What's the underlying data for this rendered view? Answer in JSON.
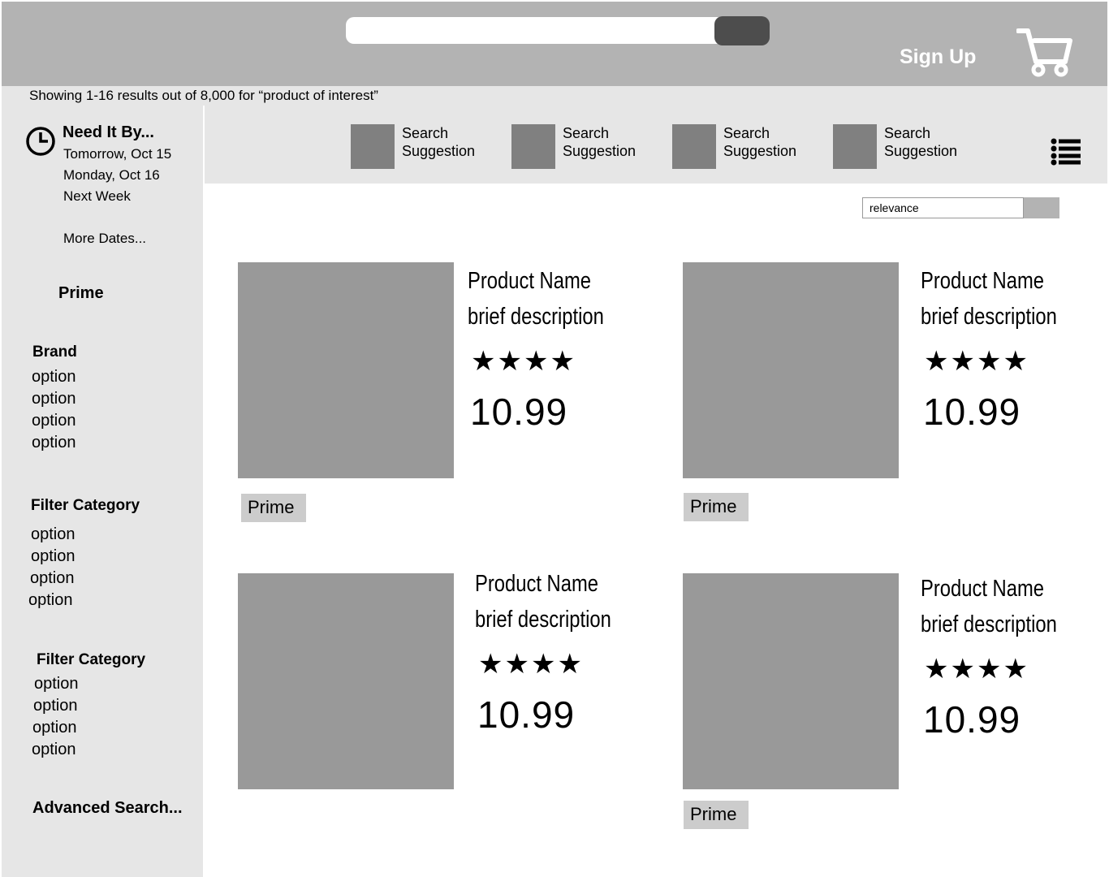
{
  "header": {
    "search_placeholder": "",
    "signup_label": "Sign Up",
    "cart_icon": "cart-icon"
  },
  "results_text": "Showing 1-16 results out of 8,000 for “product of interest”",
  "sidebar": {
    "need_it": {
      "title": "Need It By...",
      "dates": [
        "Tomorrow, Oct 15",
        "Monday, Oct 16",
        "Next Week"
      ],
      "more": "More Dates..."
    },
    "prime_label": "Prime",
    "brand": {
      "title": "Brand",
      "options": [
        "option",
        "option",
        "option",
        "option"
      ]
    },
    "filter1": {
      "title": "Filter Category",
      "options": [
        "option",
        "option",
        "option",
        "option"
      ]
    },
    "filter2": {
      "title": "Filter Category",
      "options": [
        "option",
        "option",
        "option",
        "option"
      ]
    },
    "advanced": "Advanced Search..."
  },
  "suggestions": [
    {
      "line1": "Search",
      "line2": "Suggestion"
    },
    {
      "line1": "Search",
      "line2": "Suggestion"
    },
    {
      "line1": "Search",
      "line2": "Suggestion"
    },
    {
      "line1": "Search",
      "line2": "Suggestion"
    }
  ],
  "sort": {
    "value": "relevance"
  },
  "products": [
    {
      "name": "Product Name",
      "description": "brief description",
      "stars": 4,
      "stars_text": "★★★★",
      "price": "10.99",
      "prime": "Prime"
    },
    {
      "name": "Product Name",
      "description": "brief description",
      "stars": 4,
      "stars_text": "★★★★",
      "price": "10.99",
      "prime": "Prime"
    },
    {
      "name": "Product Name",
      "description": "brief description",
      "stars": 4,
      "stars_text": "★★★★",
      "price": "10.99",
      "prime": ""
    },
    {
      "name": "Product Name",
      "description": "brief description",
      "stars": 4,
      "stars_text": "★★★★",
      "price": "10.99",
      "prime": "Prime"
    }
  ],
  "colors": {
    "header_bg": "#b3b3b3",
    "sidebar_bg": "#e6e6e6",
    "placeholder_gray": "#999999",
    "search_button": "#4d4d4d"
  }
}
